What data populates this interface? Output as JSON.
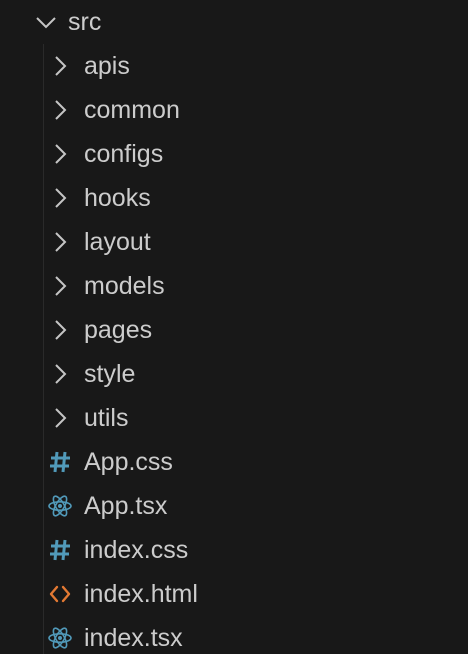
{
  "tree": {
    "root": {
      "label": "src",
      "icon": "chevron-down-icon",
      "expanded": true
    },
    "folders": [
      {
        "label": "apis",
        "icon": "chevron-right-icon"
      },
      {
        "label": "common",
        "icon": "chevron-right-icon"
      },
      {
        "label": "configs",
        "icon": "chevron-right-icon"
      },
      {
        "label": "hooks",
        "icon": "chevron-right-icon"
      },
      {
        "label": "layout",
        "icon": "chevron-right-icon"
      },
      {
        "label": "models",
        "icon": "chevron-right-icon"
      },
      {
        "label": "pages",
        "icon": "chevron-right-icon"
      },
      {
        "label": "style",
        "icon": "chevron-right-icon"
      },
      {
        "label": "utils",
        "icon": "chevron-right-icon"
      }
    ],
    "files": [
      {
        "label": "App.css",
        "icon": "css-hash-icon",
        "color": "#519aba"
      },
      {
        "label": "App.tsx",
        "icon": "react-icon",
        "color": "#519aba"
      },
      {
        "label": "index.css",
        "icon": "css-hash-icon",
        "color": "#519aba"
      },
      {
        "label": "index.html",
        "icon": "html-code-icon",
        "color": "#e37933"
      },
      {
        "label": "index.tsx",
        "icon": "react-icon",
        "color": "#519aba"
      }
    ]
  },
  "colors": {
    "background": "#181818",
    "text": "#cccccc",
    "chevron": "#c5c5c5",
    "css_icon": "#519aba",
    "react_icon": "#519aba",
    "html_icon": "#e37933"
  }
}
